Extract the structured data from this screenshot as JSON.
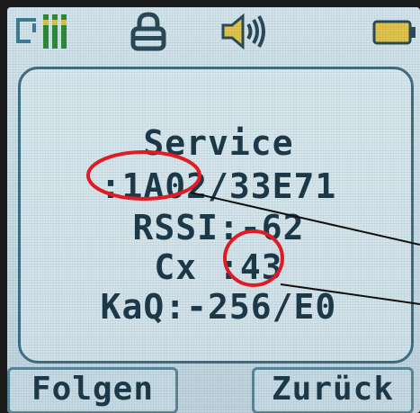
{
  "status_bar": {
    "icons": [
      "signal-icon",
      "lock-icon",
      "volume-icon",
      "battery-icon"
    ]
  },
  "service": {
    "title": "Service",
    "line1": ":1A02/33E71",
    "line2": "RSSI:-62",
    "line3": "Cx :43",
    "line4": "KaQ:-256/E0"
  },
  "softkeys": {
    "left": "Folgen",
    "right": "Zurück"
  },
  "colors": {
    "screen_bg": "#c8dce6",
    "text": "#1d3a4a",
    "frame": "#3e6f83",
    "annotation": "#e01b24"
  }
}
